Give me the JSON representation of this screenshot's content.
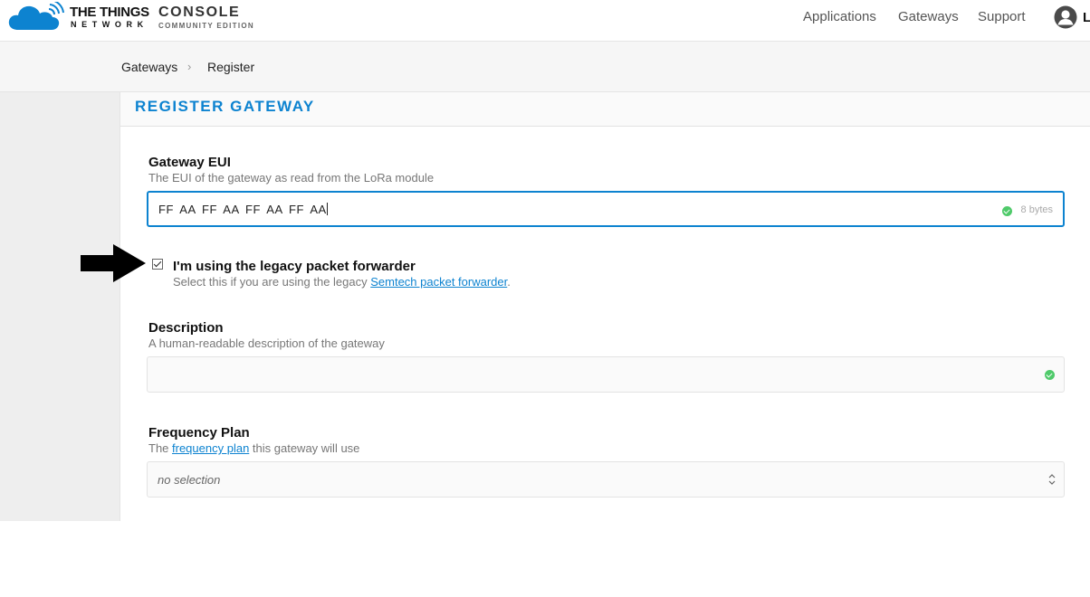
{
  "header": {
    "brand_line1": "THE THINGS",
    "brand_line2": "NETWORK",
    "product": "CONSOLE",
    "edition": "COMMUNITY EDITION",
    "nav": [
      "Applications",
      "Gateways",
      "Support"
    ],
    "user_initial": "L",
    "brand_color": "#0d83d0"
  },
  "breadcrumb": {
    "items": [
      "Gateways",
      "Register"
    ],
    "separator": "›"
  },
  "form": {
    "title": "REGISTER GATEWAY",
    "eui": {
      "label": "Gateway EUI",
      "hint": "The EUI of the gateway as read from the LoRa module",
      "value": "FF AA FF AA FF AA FF AA",
      "length_badge": "8 bytes"
    },
    "legacy": {
      "label": "I'm using the legacy packet forwarder",
      "hint_prefix": "Select this if you are using the legacy ",
      "hint_link": "Semtech packet forwarder",
      "hint_suffix": ".",
      "checked": true
    },
    "description": {
      "label": "Description",
      "hint": "A human-readable description of the gateway",
      "value": ""
    },
    "frequency": {
      "label": "Frequency Plan",
      "hint_prefix": "The ",
      "hint_link": "frequency plan",
      "hint_suffix": " this gateway will use",
      "selected": "no selection"
    }
  },
  "icons": {
    "logo": "ttn-cloud-logo",
    "user": "user-avatar-icon",
    "annotation": "black-arrow-pointer",
    "valid": "check-circle-icon",
    "select": "up-down-chevron-icon"
  },
  "colors": {
    "accent": "#0d83d0",
    "valid": "#4fca6a"
  }
}
